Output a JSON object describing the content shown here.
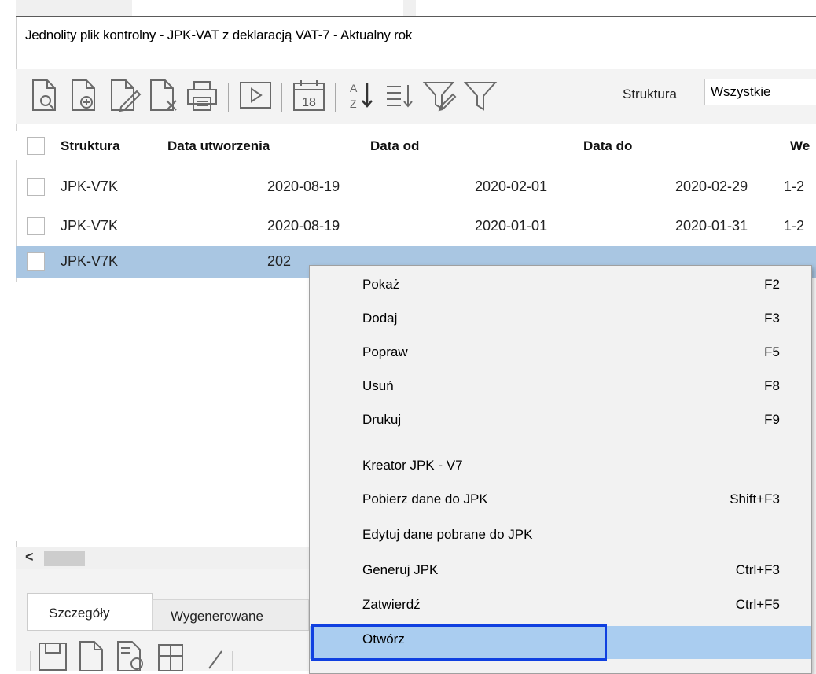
{
  "window": {
    "title": "Jednolity plik kontrolny - JPK-VAT z deklaracją VAT-7 - Aktualny rok"
  },
  "toolbar": {
    "icons": [
      "show-document-icon",
      "add-document-icon",
      "edit-document-icon",
      "delete-document-icon",
      "print-icon",
      "run-icon",
      "calendar-icon",
      "sort-az-icon",
      "sort-list-icon",
      "filter-edit-icon",
      "filter-icon"
    ],
    "calendar_day": "18",
    "sort_az_top": "A",
    "sort_az_bottom": "Z",
    "filter_label": "Struktura",
    "filter_value": "Wszystkie"
  },
  "table": {
    "columns": [
      "Struktura",
      "Data utworzenia",
      "Data od",
      "Data do",
      "We"
    ],
    "rows": [
      {
        "struktura": "JPK-V7K",
        "data_utworzenia": "2020-08-19",
        "data_od": "2020-02-01",
        "data_do": "2020-02-29",
        "we": "1-2"
      },
      {
        "struktura": "JPK-V7K",
        "data_utworzenia": "2020-08-19",
        "data_od": "2020-01-01",
        "data_do": "2020-01-31",
        "we": "1-2"
      },
      {
        "struktura": "JPK-V7K",
        "data_utworzenia": "202",
        "data_od": "",
        "data_do": "",
        "we": ""
      }
    ]
  },
  "bottom_tabs": [
    "Szczegóły",
    "Wygenerowane"
  ],
  "scroll": {
    "left_arrow": "<"
  },
  "context_menu": {
    "items": [
      {
        "label": "Pokaż",
        "shortcut": "F2"
      },
      {
        "label": "Dodaj",
        "shortcut": "F3"
      },
      {
        "label": "Popraw",
        "shortcut": "F5"
      },
      {
        "label": "Usuń",
        "shortcut": "F8"
      },
      {
        "label": "Drukuj",
        "shortcut": "F9"
      },
      {
        "label": "Kreator JPK - V7",
        "shortcut": ""
      },
      {
        "label": "Pobierz dane do JPK",
        "shortcut": "Shift+F3"
      },
      {
        "label": "Edytuj dane pobrane do JPK",
        "shortcut": ""
      },
      {
        "label": "Generuj JPK",
        "shortcut": "Ctrl+F3"
      },
      {
        "label": "Zatwierdź",
        "shortcut": "Ctrl+F5"
      },
      {
        "label": "Otwórz",
        "shortcut": ""
      }
    ],
    "highlighted_item": "Otwórz"
  },
  "colors": {
    "selected_row": "#a9c6e2",
    "menu_highlight": "#aacdf0",
    "focus_box": "#1040e0"
  }
}
